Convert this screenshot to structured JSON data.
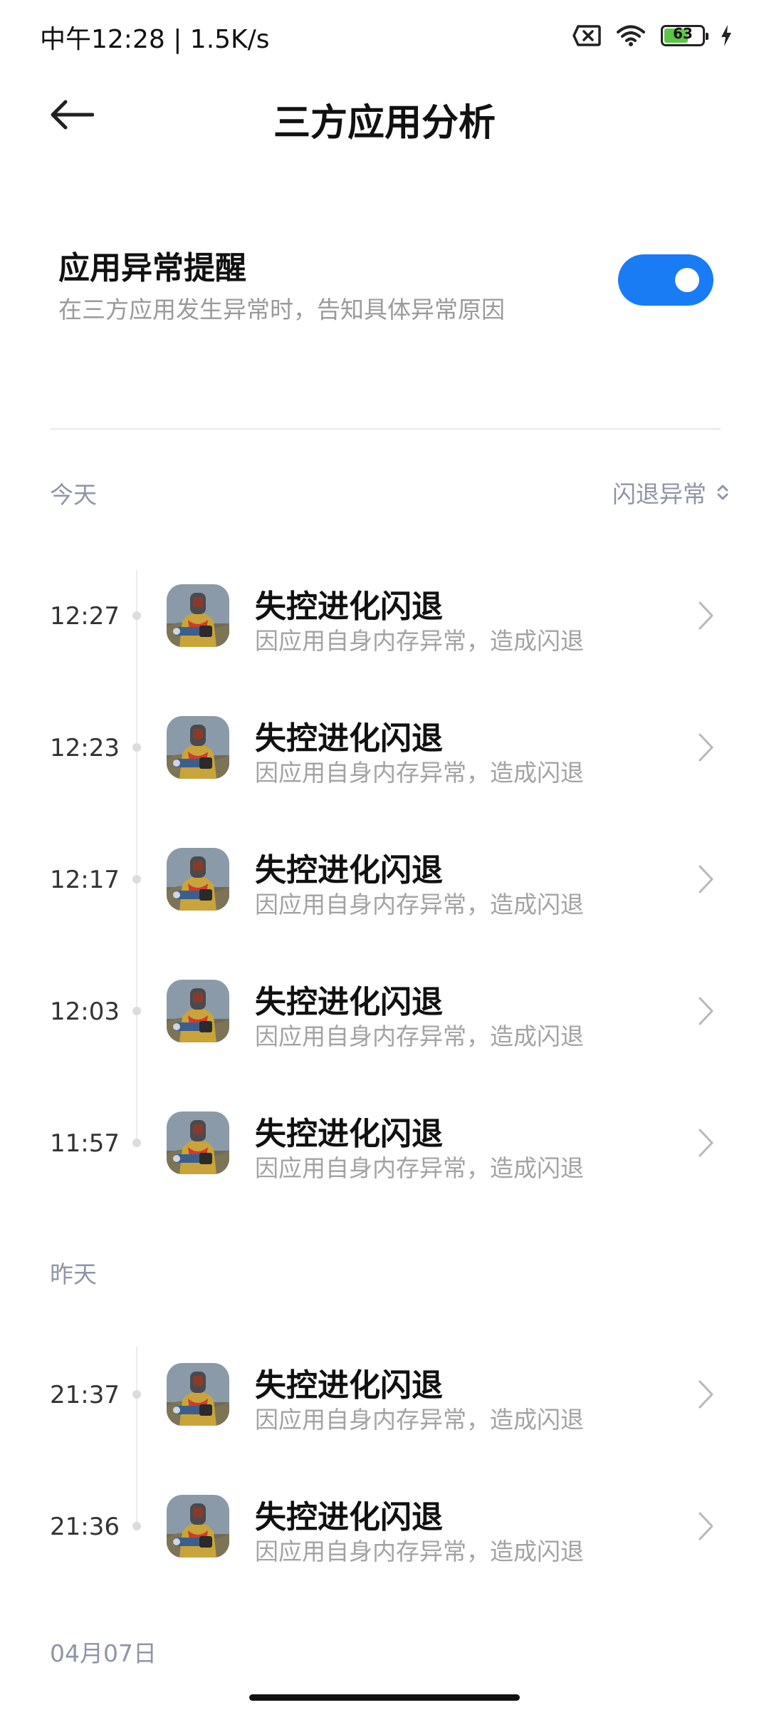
{
  "status_bar": {
    "time": "中午12:28",
    "separator": "|",
    "speed": "1.5K/s",
    "battery_level": 63,
    "battery_text": "63",
    "icons": [
      "sim-error-icon",
      "wifi-icon",
      "battery-icon",
      "charging-icon"
    ]
  },
  "header": {
    "title": "三方应用分析",
    "back_icon": "back-arrow-icon"
  },
  "alert_setting": {
    "title": "应用异常提醒",
    "description": "在三方应用发生异常时，告知具体异常原因",
    "enabled": true
  },
  "colors": {
    "accent": "#1a7cf5",
    "section_label": "#8e95a8",
    "secondary_text": "#a3a3a3"
  },
  "sections": [
    {
      "label": "今天",
      "filter_label": "闪退异常",
      "entries": [
        {
          "time": "12:27",
          "title": "失控进化闪退",
          "desc": "因应用自身内存异常，造成闪退"
        },
        {
          "time": "12:23",
          "title": "失控进化闪退",
          "desc": "因应用自身内存异常，造成闪退"
        },
        {
          "time": "12:17",
          "title": "失控进化闪退",
          "desc": "因应用自身内存异常，造成闪退"
        },
        {
          "time": "12:03",
          "title": "失控进化闪退",
          "desc": "因应用自身内存异常，造成闪退"
        },
        {
          "time": "11:57",
          "title": "失控进化闪退",
          "desc": "因应用自身内存异常，造成闪退"
        }
      ]
    },
    {
      "label": "昨天",
      "entries": [
        {
          "time": "21:37",
          "title": "失控进化闪退",
          "desc": "因应用自身内存异常，造成闪退"
        },
        {
          "time": "21:36",
          "title": "失控进化闪退",
          "desc": "因应用自身内存异常，造成闪退"
        }
      ]
    },
    {
      "label": "04月07日",
      "entries": []
    }
  ]
}
